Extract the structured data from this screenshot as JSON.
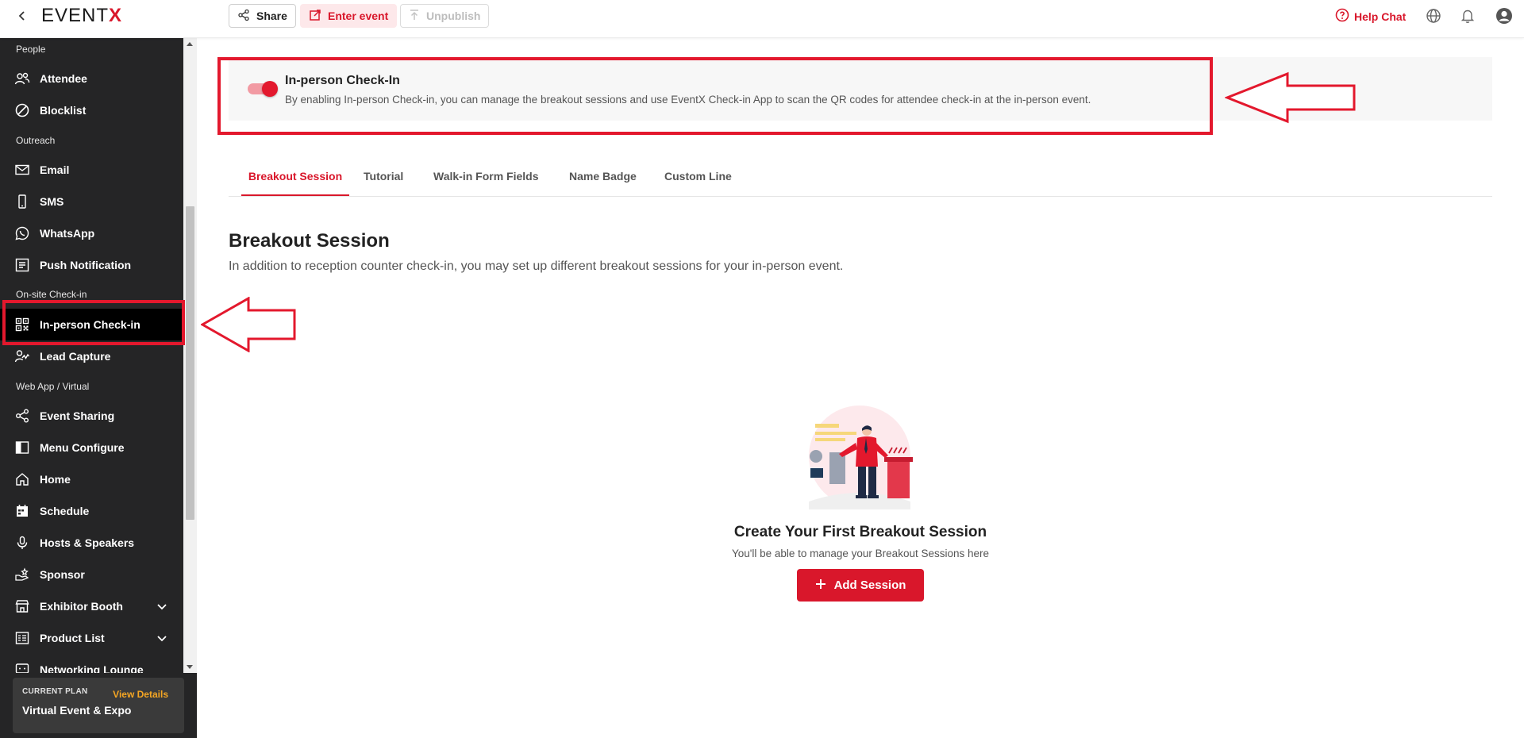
{
  "header": {
    "logo_main": "EVENT",
    "logo_accent": "X",
    "share_label": "Share",
    "enter_label": "Enter event",
    "unpublish_label": "Unpublish",
    "help_label": "Help Chat",
    "icons": [
      "back-icon",
      "share-icon",
      "external-link-icon",
      "upload-icon",
      "help-circle-icon",
      "globe-icon",
      "bell-icon",
      "account-icon"
    ]
  },
  "sidebar": {
    "sections": {
      "people": "People",
      "outreach": "Outreach",
      "onsite": "On-site Check-in",
      "webapp": "Web App / Virtual"
    },
    "items": [
      {
        "label": "Attendee",
        "icon": "users-icon"
      },
      {
        "label": "Blocklist",
        "icon": "block-icon"
      },
      {
        "label": "Email",
        "icon": "mail-icon"
      },
      {
        "label": "SMS",
        "icon": "phone-icon"
      },
      {
        "label": "WhatsApp",
        "icon": "whatsapp-icon"
      },
      {
        "label": "Push Notification",
        "icon": "push-notification-icon"
      },
      {
        "label": "In-person Check-in",
        "icon": "qr-code-icon",
        "active": true
      },
      {
        "label": "Lead Capture",
        "icon": "lead-capture-icon"
      },
      {
        "label": "Event Sharing",
        "icon": "share-icon"
      },
      {
        "label": "Menu Configure",
        "icon": "layout-icon"
      },
      {
        "label": "Home",
        "icon": "home-icon"
      },
      {
        "label": "Schedule",
        "icon": "calendar-icon"
      },
      {
        "label": "Hosts & Speakers",
        "icon": "microphone-icon"
      },
      {
        "label": "Sponsor",
        "icon": "sponsor-icon"
      },
      {
        "label": "Exhibitor Booth",
        "icon": "store-icon",
        "expandable": true
      },
      {
        "label": "Product List",
        "icon": "list-icon",
        "expandable": true
      },
      {
        "label": "Networking Lounge",
        "icon": "chat-icon"
      }
    ],
    "plan": {
      "label": "CURRENT PLAN",
      "link": "View Details",
      "name": "Virtual Event & Expo"
    }
  },
  "checkin_card": {
    "title": "In-person Check-In",
    "description": "By enabling In-person Check-in, you can manage the breakout sessions and use EventX Check-in App to scan the QR codes for attendee check-in at the in-person event.",
    "enabled": true
  },
  "tabs": [
    {
      "label": "Breakout Session",
      "active": true
    },
    {
      "label": "Tutorial"
    },
    {
      "label": "Walk-in Form Fields"
    },
    {
      "label": "Name Badge"
    },
    {
      "label": "Custom Line"
    }
  ],
  "section": {
    "title": "Breakout Session",
    "subtitle": "In addition to reception counter check-in, you may set up different breakout sessions for your in-person event."
  },
  "empty_state": {
    "title": "Create Your First Breakout Session",
    "subtitle": "You'll be able to manage your Breakout Sessions here",
    "button": "Add Session"
  },
  "colors": {
    "accent": "#d9172b",
    "sidebar_bg": "#252526",
    "annotation": "#e3182d",
    "plan_link": "#f5a623"
  }
}
